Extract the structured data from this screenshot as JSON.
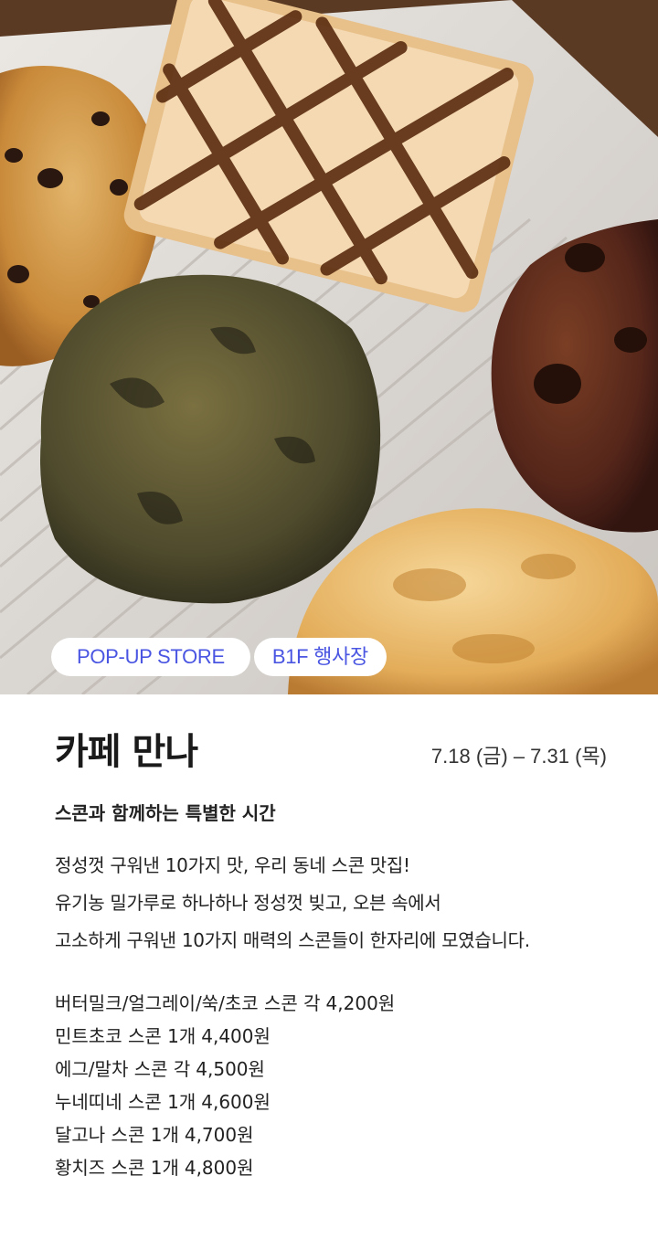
{
  "hero": {
    "tags": [
      "POP-UP STORE",
      "B1F 행사장"
    ]
  },
  "event": {
    "title": "카페 만나",
    "date": "7.18 (금) – 7.31 (목)",
    "subtitle": "스콘과 함께하는 특별한 시간",
    "description": [
      "정성껏 구워낸 10가지 맛, 우리 동네 스콘 맛집!",
      "유기농 밀가루로 하나하나 정성껏 빚고, 오븐 속에서",
      "고소하게 구워낸 10가지 매력의 스콘들이 한자리에 모였습니다."
    ],
    "menu": [
      {
        "name": "버터밀크/얼그레이/쑥/초코 스콘 각",
        "price": "4,200원"
      },
      {
        "name": "민트초코 스콘 1개",
        "price": "4,400원"
      },
      {
        "name": "에그/말차 스콘 각",
        "price": "4,500원"
      },
      {
        "name": "누네띠네 스콘 1개",
        "price": "4,600원"
      },
      {
        "name": "달고나 스콘 1개",
        "price": "4,700원"
      },
      {
        "name": "황치즈 스콘 1개",
        "price": "4,800원"
      }
    ]
  },
  "colors": {
    "tag_text": "#4a56e2",
    "tag_bg": "#ffffff"
  }
}
